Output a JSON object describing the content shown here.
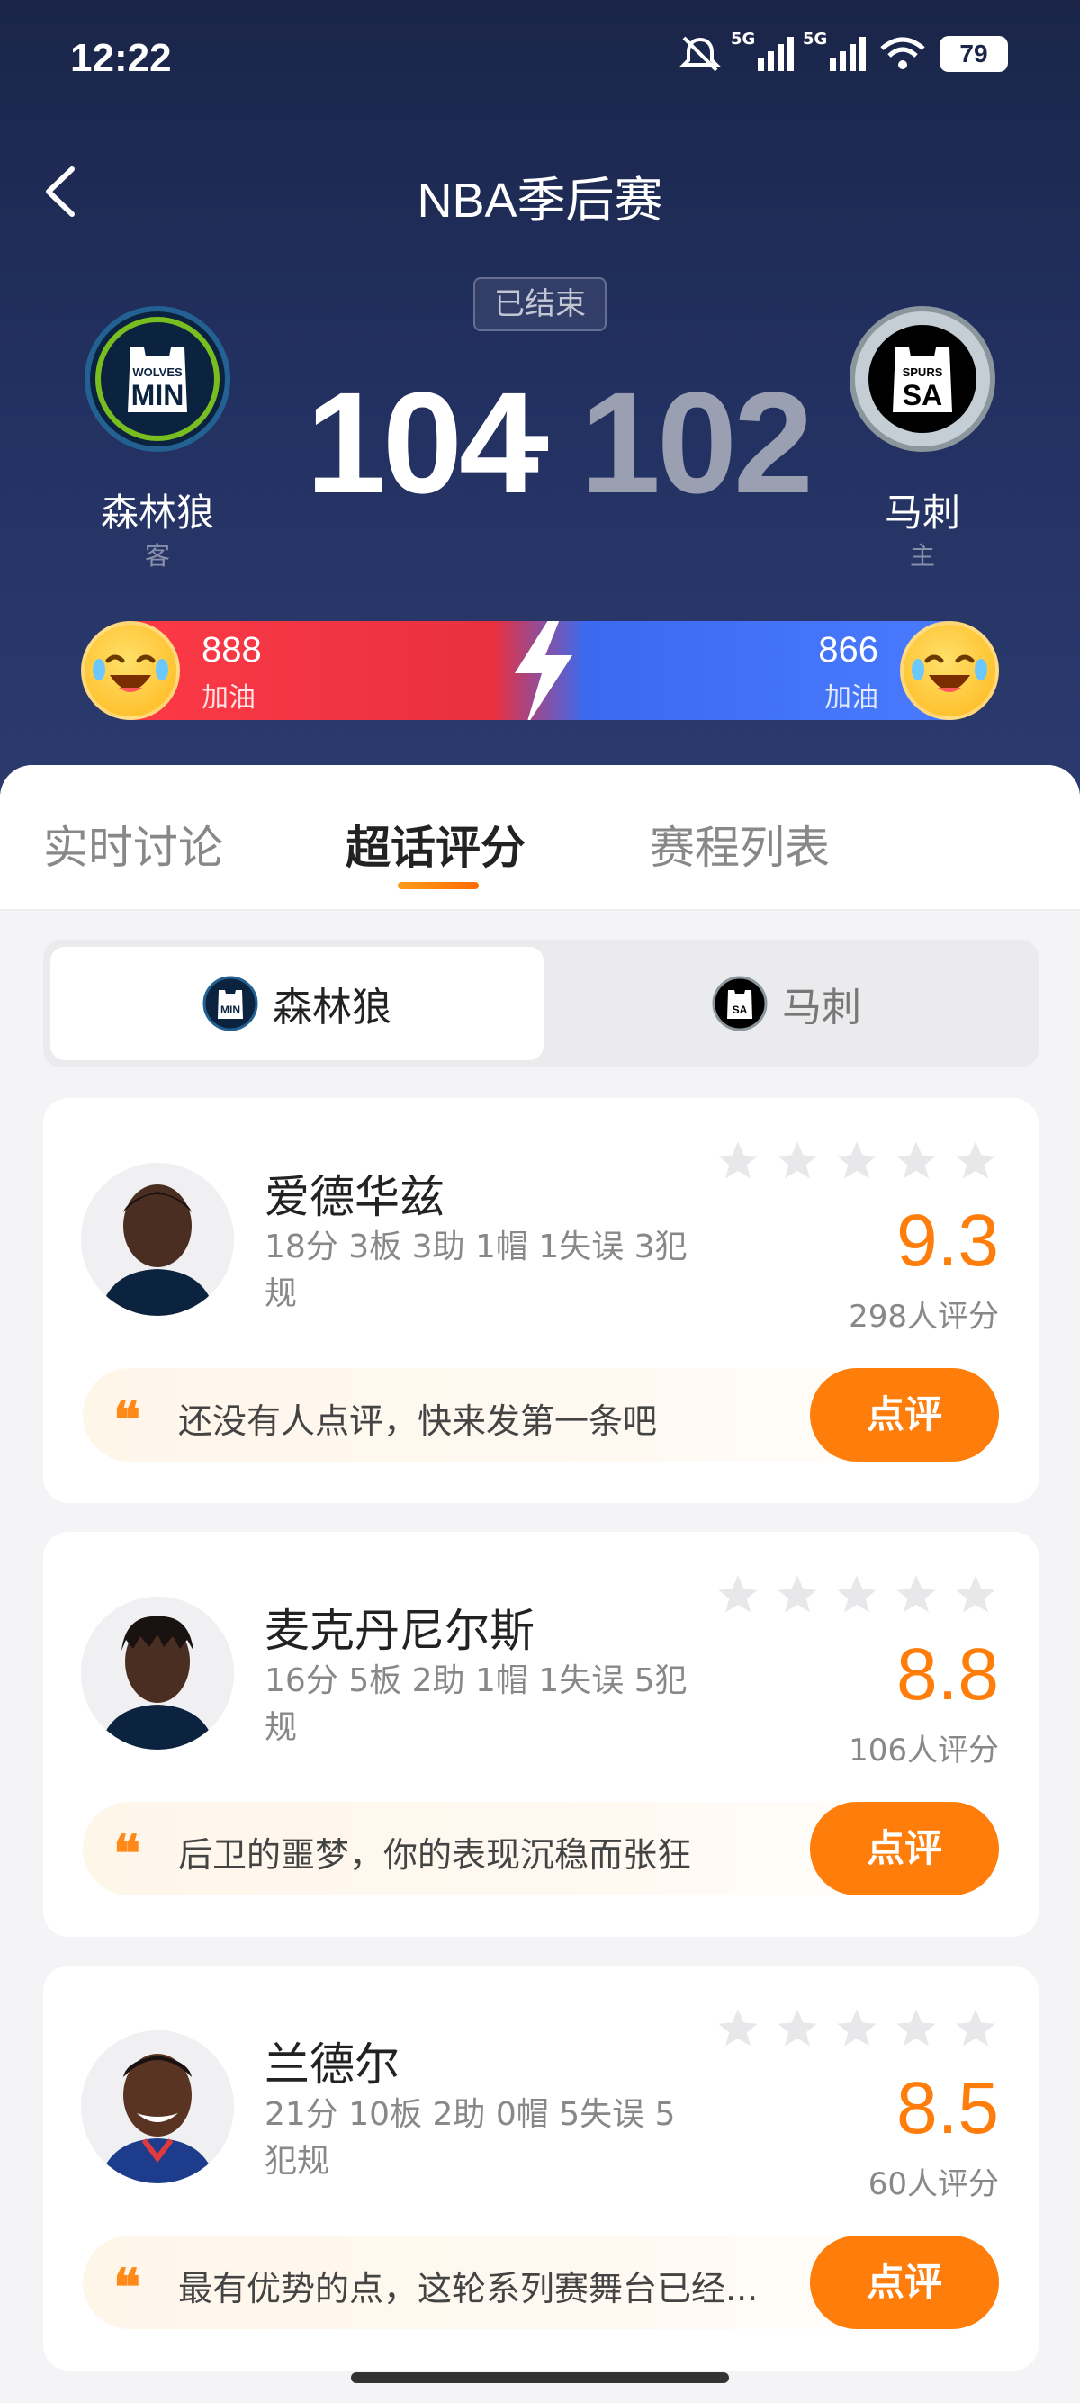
{
  "status_bar": {
    "time": "12:22",
    "network1": "5G",
    "network2": "5G",
    "battery": "79"
  },
  "header": {
    "title": "NBA季后赛",
    "game_status": "已结束"
  },
  "teams": {
    "home": {
      "name": "森林狼",
      "role": "客",
      "score": "104",
      "logo_top": "WOLVES",
      "logo_main": "MIN"
    },
    "away": {
      "name": "马刺",
      "role": "主",
      "score": "102",
      "logo_top": "SPURS",
      "logo_main": "SA"
    },
    "dash": "-"
  },
  "cheer": {
    "left_count": "888",
    "left_label": "加油",
    "right_count": "866",
    "right_label": "加油"
  },
  "tabs": [
    {
      "label": "实时讨论"
    },
    {
      "label": "超话评分"
    },
    {
      "label": "赛程列表"
    }
  ],
  "team_switch": {
    "active": "森林狼",
    "inactive": "马刺"
  },
  "players": [
    {
      "name": "爱德华兹",
      "stats": "18分 3板 3助 1帽 1失误 3犯规",
      "rating": "9.3",
      "rating_count": "298人评分",
      "comment": "还没有人点评，快来发第一条吧",
      "button": "点评"
    },
    {
      "name": "麦克丹尼尔斯",
      "stats": "16分 5板 2助 1帽 1失误 5犯规",
      "rating": "8.8",
      "rating_count": "106人评分",
      "comment": "后卫的噩梦，你的表现沉稳而张狂",
      "button": "点评"
    },
    {
      "name": "兰德尔",
      "stats": "21分 10板 2助 0帽 5失误 5犯规",
      "rating": "8.5",
      "rating_count": "60人评分",
      "comment": "最有优势的点，这轮系列赛舞台已经...",
      "button": "点评"
    }
  ],
  "colors": {
    "accent": "#ff7d0a",
    "header_bg": "#1a2548",
    "red": "#ff3b47",
    "blue": "#4b7cff"
  }
}
